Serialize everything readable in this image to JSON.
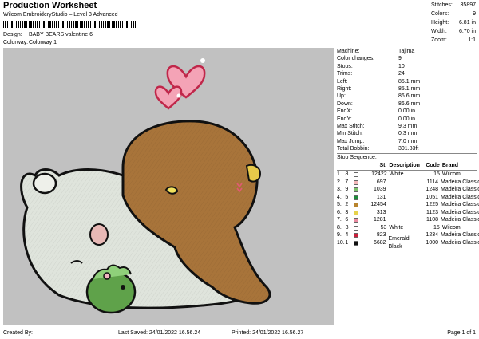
{
  "header": {
    "title": "Production Worksheet",
    "subtitle": "Wilcom EmbroideryStudio – Level 3 Advanced",
    "design_label": "Design:",
    "design_value": "BABY BEARS valentine 6",
    "colorway_label": "Colorway:",
    "colorway_value": "Colorway 1"
  },
  "stats": [
    {
      "label": "Stitches:",
      "value": "35897"
    },
    {
      "label": "Colors:",
      "value": "9"
    },
    {
      "label": "Height:",
      "value": "6.81 in"
    },
    {
      "label": "Width:",
      "value": "6.70 in"
    },
    {
      "label": "Zoom:",
      "value": "1:1"
    }
  ],
  "machine_info": [
    {
      "label": "Machine:",
      "value": "Tajima"
    },
    {
      "label": "Color changes:",
      "value": "9"
    },
    {
      "label": "Stops:",
      "value": "10"
    },
    {
      "label": "Trims:",
      "value": "24"
    },
    {
      "label": "Left:",
      "value": "85.1 mm"
    },
    {
      "label": "Right:",
      "value": "85.1 mm"
    },
    {
      "label": "Up:",
      "value": "86.6 mm"
    },
    {
      "label": "Down:",
      "value": "86.6 mm"
    },
    {
      "label": "EndX:",
      "value": "0.00 in"
    },
    {
      "label": "EndY:",
      "value": "0.00 in"
    },
    {
      "label": "Max Stitch:",
      "value": "9.3 mm"
    },
    {
      "label": "Min Stitch:",
      "value": "0.3 mm"
    },
    {
      "label": "Max Jump:",
      "value": "7.0 mm"
    },
    {
      "label": "Total Bobbin:",
      "value": "301.83ft"
    }
  ],
  "sequence": {
    "title": "Stop Sequence:",
    "headers": [
      "",
      "",
      "",
      "St.",
      "Description",
      "Code",
      "Brand"
    ],
    "rows": [
      {
        "n": "1.",
        "c": "8",
        "color": "#ffffff",
        "st": "12422",
        "desc": "White",
        "code": "15",
        "brand": "Wilcom"
      },
      {
        "n": "2.",
        "c": "7",
        "color": "#f3b7b9",
        "st": "697",
        "desc": "",
        "code": "1114",
        "brand": "Madeira Classic 40"
      },
      {
        "n": "3.",
        "c": "9",
        "color": "#7bc26a",
        "st": "1039",
        "desc": "",
        "code": "1248",
        "brand": "Madeira Classic 40"
      },
      {
        "n": "4.",
        "c": "5",
        "color": "#1e8a3a",
        "st": "131",
        "desc": "",
        "code": "1051",
        "brand": "Madeira Classic 40"
      },
      {
        "n": "5.",
        "c": "2",
        "color": "#b8842d",
        "st": "12454",
        "desc": "",
        "code": "1225",
        "brand": "Madeira Classic 40"
      },
      {
        "n": "6.",
        "c": "3",
        "color": "#e6d24c",
        "st": "313",
        "desc": "",
        "code": "1123",
        "brand": "Madeira Classic 40"
      },
      {
        "n": "7.",
        "c": "6",
        "color": "#e98aa0",
        "st": "1281",
        "desc": "",
        "code": "1108",
        "brand": "Madeira Classic 40"
      },
      {
        "n": "8.",
        "c": "8",
        "color": "#ffffff",
        "st": "53",
        "desc": "White",
        "code": "15",
        "brand": "Wilcom"
      },
      {
        "n": "9.",
        "c": "4",
        "color": "#c8203c",
        "st": "823",
        "desc": "",
        "code": "1234",
        "brand": "Madeira Classic 40"
      },
      {
        "n": "10.",
        "c": "1",
        "color": "#111111",
        "st": "6682",
        "desc": "Emerald Black",
        "code": "1000",
        "brand": "Madeira Classic 40"
      }
    ]
  },
  "footer": {
    "created": "Created By:",
    "saved": "Last Saved: 24/01/2022 16.56.24",
    "printed": "Printed: 24/01/2022 16.56.27",
    "page": "Page 1 of 1"
  }
}
